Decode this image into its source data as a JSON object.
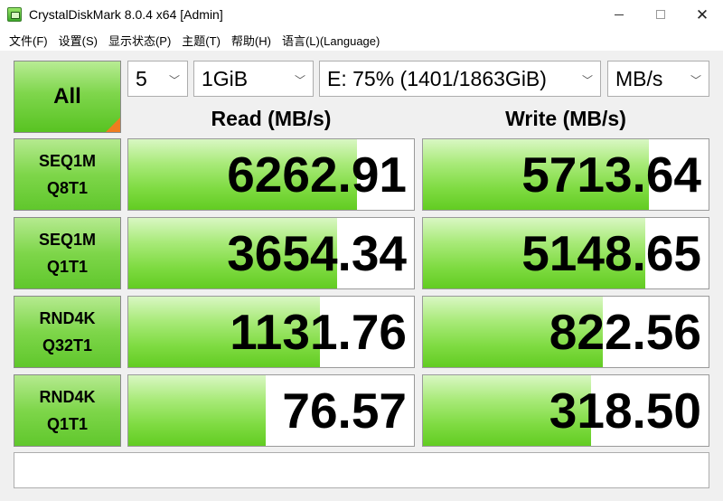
{
  "window": {
    "title": "CrystalDiskMark 8.0.4 x64 [Admin]"
  },
  "menu": [
    {
      "label": "文件(F)"
    },
    {
      "label": "设置(S)"
    },
    {
      "label": "显示状态(P)"
    },
    {
      "label": "主题(T)"
    },
    {
      "label": "帮助(H)"
    },
    {
      "label": "语言(L)(Language)"
    }
  ],
  "controls": {
    "all_label": "All",
    "count_value": "5",
    "size_value": "1GiB",
    "drive_value": "E: 75% (1401/1863GiB)",
    "unit_value": "MB/s"
  },
  "headers": {
    "read": "Read (MB/s)",
    "write": "Write (MB/s)"
  },
  "rows": [
    {
      "line1": "SEQ1M",
      "line2": "Q8T1",
      "read": "6262.91",
      "write": "5713.64",
      "read_fill": 0.8,
      "write_fill": 0.79
    },
    {
      "line1": "SEQ1M",
      "line2": "Q1T1",
      "read": "3654.34",
      "write": "5148.65",
      "read_fill": 0.73,
      "write_fill": 0.78
    },
    {
      "line1": "RND4K",
      "line2": "Q32T1",
      "read": "1131.76",
      "write": "822.56",
      "read_fill": 0.67,
      "write_fill": 0.63
    },
    {
      "line1": "RND4K",
      "line2": "Q1T1",
      "read": "76.57",
      "write": "318.50",
      "read_fill": 0.48,
      "write_fill": 0.59
    }
  ],
  "comment": ""
}
